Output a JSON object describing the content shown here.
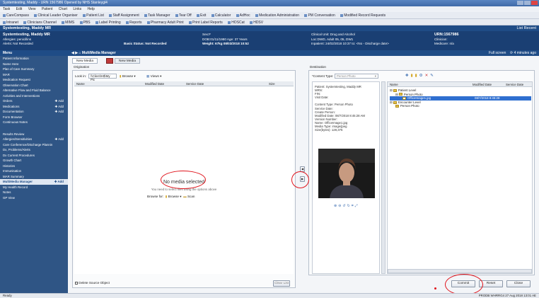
{
  "window": {
    "title": "Systemtesting, Maddy - URN 1567986 Opened by NHS Stanleygl4"
  },
  "menubar": [
    "Task",
    "Edit",
    "View",
    "Patient",
    "Chart",
    "Links",
    "Help"
  ],
  "toolbar1": [
    "CareCompass",
    "Clinical Leader Organiser",
    "Patient List",
    "Staff Assignment",
    "Task Manager",
    "Tear Off",
    "Exit",
    "Calculator",
    "AdHoc",
    "Medication Administration",
    "PM Conversation",
    "Modified Record Requests"
  ],
  "toolbar2": [
    "Intranet",
    "Clinicians Channel",
    "MIMS",
    "PBS",
    "Label Printing",
    "Reports",
    "Pharmacy Adult Print",
    "Print Label Reports",
    "HOSCat",
    "HDSV"
  ],
  "patient_bar": {
    "name": "Systemtesting, Maddy  MR",
    "nav": "List  Recent"
  },
  "banner": {
    "name": "Systemtesting, Maddy  MR",
    "allergies": "Allergies: penicillins",
    "alerts": "Alerts: Not Recorded",
    "basic_status": "Basic Status: Not Recorded",
    "sex": "Sex:F",
    "dob": "DOB:01/11/1980   Age: 37 Years",
    "weight": "Weight: 67kg  08/03/2018 10:52",
    "clinical_unit": "Clinical Unit: Drug and Alcohol",
    "location": "Loc:DWD, Adult 05, 05, DW1",
    "inpatient": "Inpatient: 24/02/2018 10:37 to: <No - Discharge date>",
    "urn": "URN:1567986",
    "clinician": "Clinician:",
    "medicare": "Medicare: n/a"
  },
  "sidebar": {
    "header": "Menu",
    "items": [
      {
        "label": "Patient Information",
        "add": ""
      },
      {
        "label": "Name Here",
        "add": ""
      },
      {
        "label": "Plan of Care Summary",
        "add": ""
      },
      {
        "label": "MAR",
        "add": ""
      },
      {
        "label": "Medication Request",
        "add": ""
      },
      {
        "label": "Observation Chart",
        "add": ""
      },
      {
        "label": "Alternative Flow and Fluid Balance",
        "add": ""
      },
      {
        "label": "Activities and Interventions",
        "add": ""
      },
      {
        "label": "Orders",
        "add": "Add"
      },
      {
        "label": "Medications",
        "add": "Add"
      },
      {
        "label": "Documentation",
        "add": "Add"
      },
      {
        "label": "Form Browser",
        "add": ""
      },
      {
        "label": "Continuous Notes",
        "add": ""
      }
    ],
    "items2": [
      {
        "label": "Results Review",
        "add": ""
      },
      {
        "label": "Allergies/Sensitivities",
        "add": "Add"
      },
      {
        "label": "Care Conference/Discharge Plannin",
        "add": ""
      },
      {
        "label": "Dx, Problems/Alerts",
        "add": ""
      },
      {
        "label": "Dx Current Procedures",
        "add": ""
      },
      {
        "label": "Growth Chart",
        "add": ""
      },
      {
        "label": "Histories",
        "add": ""
      },
      {
        "label": "Immunisation",
        "add": ""
      },
      {
        "label": "MAR Summary",
        "add": ""
      },
      {
        "label": "MultiMedia Manager",
        "add": "Add",
        "active": true
      },
      {
        "label": "My Health Record",
        "add": ""
      },
      {
        "label": "Notes",
        "add": ""
      },
      {
        "label": "GP View",
        "add": ""
      }
    ]
  },
  "main": {
    "title": "MultiMedia Manager",
    "full_screen": "Full screen",
    "minutes_ago": "4 minutes ago",
    "tabs": [
      "New Media",
      "New Media"
    ],
    "origination": {
      "label": "Origination",
      "look_in_label": "Look in:",
      "look_in_value": "\\\\Client\\H$\\My Pic",
      "browse": "Browse",
      "views": "Views",
      "columns": [
        "Name",
        "Modified Date",
        "Service Date",
        "Size"
      ],
      "empty_title": "No media selected",
      "empty_sub": "You need to select files using the options above",
      "browse_label": "Browse for:",
      "browse_btn": "Browse",
      "scan_btn": "Scan",
      "delete_source": "Delete Source Object",
      "clear_list": "Clear List"
    },
    "destination": {
      "label": "Destination",
      "content_type_label": "*Content Type:",
      "content_type_value": "Person Photo",
      "info": [
        "Patient: Systemtesting, Maddy  MR",
        "MRN:",
        "FIN:",
        "Visit Date:",
        "",
        "Content Type:  Person Photo",
        "Service Date:",
        "Create Person:",
        "Modified Date:  08/7/2018 8:45:28 AM",
        "Version Number:",
        "Name:  OfficeImage1.jpg",
        "Media Type:  image/jpeg",
        "Size(bytes):  128,376"
      ],
      "tree_columns": [
        "Name",
        "Modified Date",
        "Service Date"
      ],
      "tree": [
        {
          "label": "Patient Level",
          "depth": 0
        },
        {
          "label": "Person Photo",
          "depth": 1
        },
        {
          "label": "OfficeImage1.jpg",
          "depth": 2,
          "date": "08/7/2018 8:45:28",
          "selected": true
        },
        {
          "label": "Encounter Level",
          "depth": 0
        },
        {
          "label": "Person Photo",
          "depth": 1
        }
      ]
    },
    "buttons": {
      "commit": "Commit",
      "reset": "Reset",
      "close": "Close"
    }
  },
  "status": {
    "left": "Ready",
    "right": "PRODB  WHRRG4  27 Aug 2018  13:01 AE"
  },
  "colors": {
    "header": "#1f4c86",
    "banner": "#1a3f73",
    "sidebar": "#2f5585",
    "annotation": "#e0141c"
  }
}
